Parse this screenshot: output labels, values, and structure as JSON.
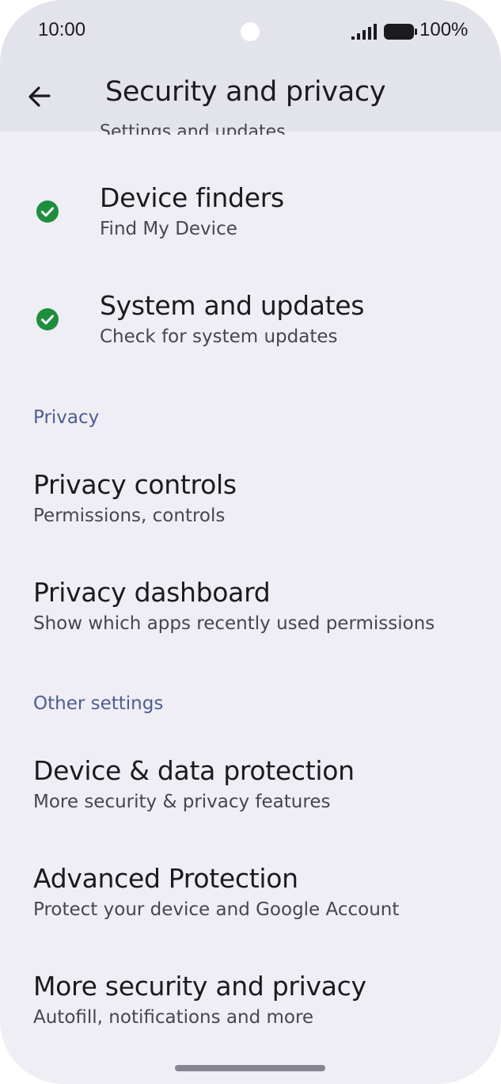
{
  "status_bar": {
    "time": "10:00",
    "battery": "100%"
  },
  "header": {
    "title": "Security and privacy"
  },
  "clipped_top": "Settings and updates",
  "items_top": [
    {
      "title": "Device finders",
      "subtitle": "Find My Device",
      "status_icon": "check-circle-icon"
    },
    {
      "title": "System and updates",
      "subtitle": "Check for system updates",
      "status_icon": "check-circle-icon"
    }
  ],
  "sections": {
    "privacy": {
      "header": "Privacy",
      "items": [
        {
          "title": "Privacy controls",
          "subtitle": "Permissions, controls"
        },
        {
          "title": "Privacy dashboard",
          "subtitle": "Show which apps recently used permissions"
        }
      ]
    },
    "other": {
      "header": "Other settings",
      "items": [
        {
          "title": "Device & data protection",
          "subtitle": "More security & privacy features"
        },
        {
          "title": "Advanced Protection",
          "subtitle": "Protect your device and Google Account"
        },
        {
          "title": "More security and privacy",
          "subtitle": "Autofill, notifications and more"
        }
      ]
    }
  },
  "colors": {
    "background": "#efeef5",
    "app_bar": "#e3e3ec",
    "check_green": "#1e8e3e",
    "section_header": "#4e5d92"
  }
}
